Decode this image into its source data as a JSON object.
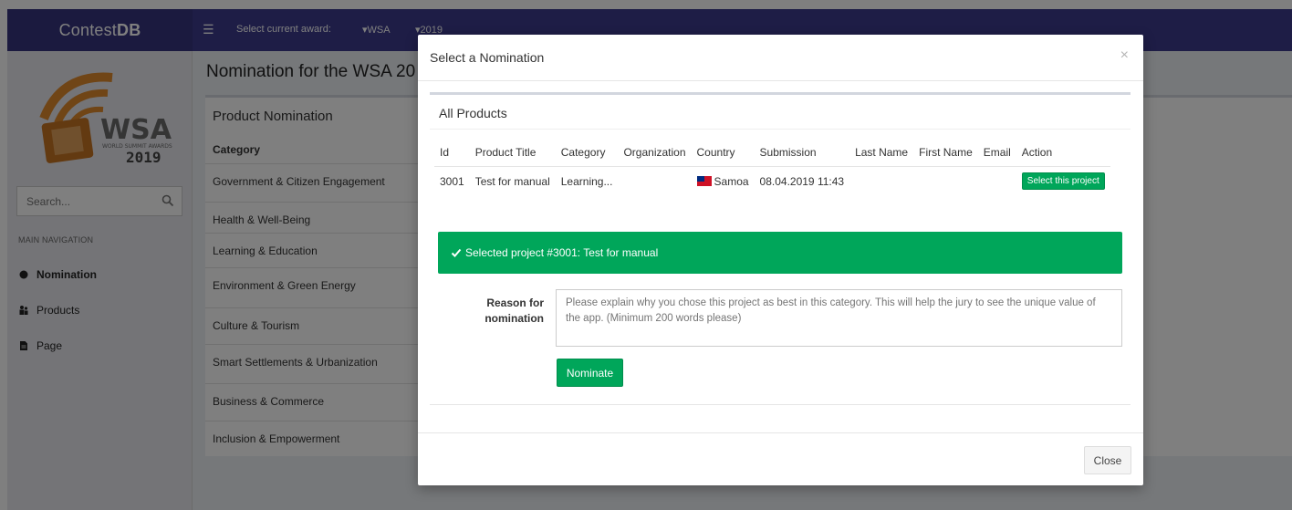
{
  "app": {
    "brand_prefix": "Contest",
    "brand_suffix": "DB",
    "award_label": "Select current award:",
    "award_value": "WSA",
    "year_value": "2019"
  },
  "sidebar": {
    "search_placeholder": "Search...",
    "nav_header": "MAIN NAVIGATION",
    "items": [
      {
        "label": "Nomination",
        "icon": "circle-icon",
        "active": true
      },
      {
        "label": "Products",
        "icon": "users-icon"
      },
      {
        "label": "Page",
        "icon": "file-icon"
      }
    ],
    "logo": {
      "main": "WSA",
      "sub": "WORLD SUMMIT AWARDS",
      "year": "2019"
    }
  },
  "main": {
    "title": "Nomination for the WSA 20",
    "panel_title": "Product Nomination",
    "category_header": "Category",
    "categories": [
      "Government & Citizen Engagement",
      "Health & Well-Being",
      "Learning & Education",
      "Environment & Green Energy",
      "Culture & Tourism",
      "Smart Settlements & Urbanization",
      "Business & Commerce",
      "Inclusion & Empowerment"
    ]
  },
  "modal": {
    "title": "Select a Nomination",
    "close_x": "×",
    "products_title": "All Products",
    "columns": [
      "Id",
      "Product Title",
      "Category",
      "Organization",
      "Country",
      "Submission",
      "Last Name",
      "First Name",
      "Email",
      "Action"
    ],
    "rows": [
      {
        "id": "3001",
        "title": "Test for manual",
        "category": "Learning...",
        "organization": "",
        "country": "Samoa",
        "submission": "08.04.2019 11:43",
        "last_name": "",
        "first_name": "",
        "email": "",
        "action": "Select this project"
      }
    ],
    "selected_alert": "Selected project #3001: Test for manual",
    "reason_label_1": "Reason for",
    "reason_label_2": "nomination",
    "reason_placeholder": "Please explain why you chose this project as best in this category. This will help the jury to see the unique value of the app. (Minimum 200 words please)",
    "nominate_button": "Nominate",
    "close_button": "Close"
  },
  "colors": {
    "topbar": "#3c3a8d",
    "success": "#00a65a",
    "link": "#3c8dbc"
  }
}
